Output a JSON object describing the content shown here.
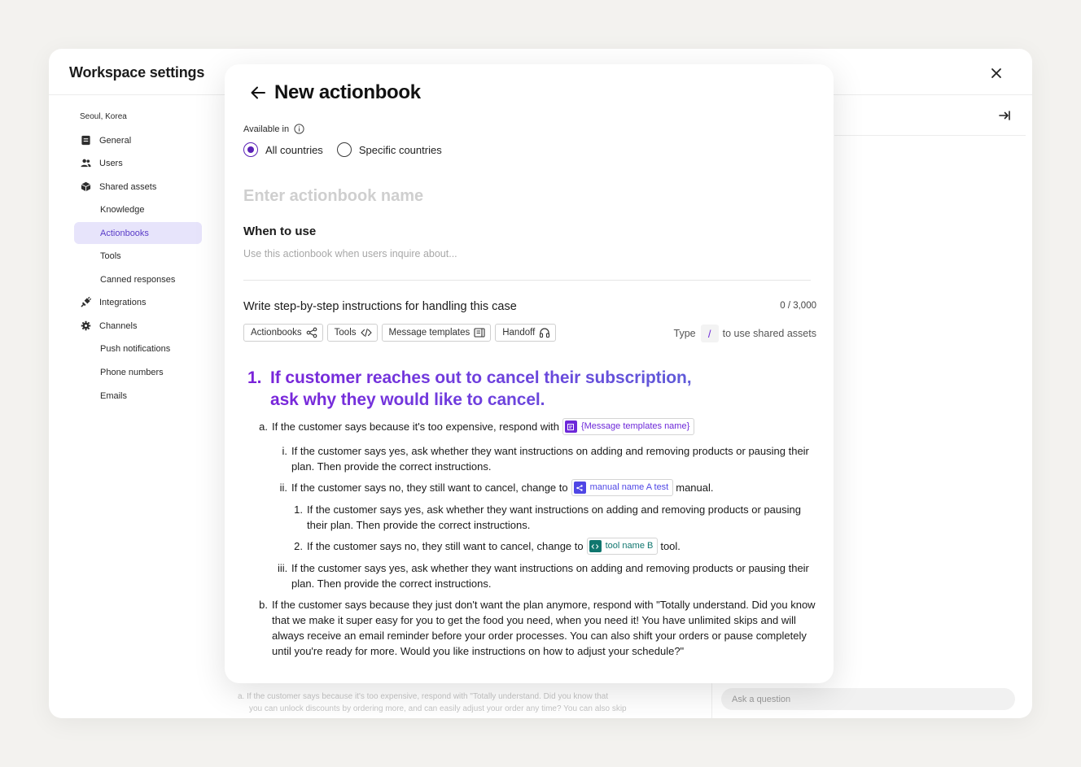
{
  "window": {
    "title": "Workspace settings",
    "close_icon": "close-icon"
  },
  "sidebar": {
    "workspace_location": "Seoul, Korea",
    "items": [
      {
        "label": "General",
        "icon": "document-icon"
      },
      {
        "label": "Users",
        "icon": "users-icon"
      },
      {
        "label": "Shared assets",
        "icon": "cube-icon"
      },
      {
        "label": "Knowledge"
      },
      {
        "label": "Actionbooks",
        "active": true
      },
      {
        "label": "Tools"
      },
      {
        "label": "Canned responses"
      },
      {
        "label": "Integrations",
        "icon": "plug-icon"
      },
      {
        "label": "Channels",
        "icon": "gear-icon"
      },
      {
        "label": "Push notifications"
      },
      {
        "label": "Phone numbers"
      },
      {
        "label": "Emails"
      }
    ]
  },
  "right_pane": {
    "collapse_icon": "arrow-right-bar-icon",
    "ask_placeholder": "Ask a question"
  },
  "background_content": {
    "line1": "a. If the customer says because it's too expensive, respond with \"Totally understand. Did you know that",
    "line2": "you can unlock discounts by ordering more, and can easily adjust your order any time? You can also skip"
  },
  "modal": {
    "title": "New actionbook",
    "available_in_label": "Available in",
    "radio_all": "All countries",
    "radio_specific": "Specific countries",
    "radio_selected": "All countries",
    "name_placeholder": "Enter actionbook name",
    "when_label": "When to use",
    "when_placeholder": "Use this actionbook when users inquire about...",
    "steps_label": "Write step-by-step instructions for handling this case",
    "char_count": "0 / 3,000",
    "chips": {
      "actionbooks": "Actionbooks",
      "tools": "Tools",
      "message_templates": "Message templates",
      "handoff": "Handoff"
    },
    "type_hint_prefix": "Type",
    "type_hint_key": "/",
    "type_hint_suffix": "to use shared assets"
  },
  "instructions": {
    "step1_num": "1.",
    "step1_line1": "If customer reaches out to cancel their subscription,",
    "step1_line2": "ask why they would like to cancel.",
    "a_marker": "a.",
    "a_text": "If the customer says because it's too expensive, respond with",
    "a_asset": "{Message templates name}",
    "a_i_marker": "i.",
    "a_i_text": "If the customer says yes, ask whether they want instructions on adding and removing products or pausing their plan. Then provide the correct instructions.",
    "a_ii_marker": "ii.",
    "a_ii_text": "If the customer says no, they still want to cancel, change to",
    "a_ii_asset": "manual name A test",
    "a_ii_suffix": "manual.",
    "a_ii_1_marker": "1.",
    "a_ii_1_text": "If the customer says yes, ask whether they want instructions on adding and removing products or pausing their plan. Then provide the correct instructions.",
    "a_ii_2_marker": "2.",
    "a_ii_2_text": "If the customer says no, they still want to cancel, change to",
    "a_ii_2_asset": "tool name B",
    "a_ii_2_suffix": "tool.",
    "a_iii_marker": "iii.",
    "a_iii_text": "If the customer says yes, ask whether they want instructions on adding and removing products or pausing their plan. Then provide the correct instructions.",
    "b_marker": "b.",
    "b_text": "If the customer says because they just don't want the plan anymore, respond with \"Totally understand. Did you know that we make it super easy for you to get the food you need, when you need it! You have unlimited skips and will always receive an email reminder before your order processes. You can also shift your orders or pause completely until you're ready for more. Would you like instructions on how to adjust your schedule?\""
  },
  "colors": {
    "accent_purple": "#6d28d9",
    "active_nav_bg": "#e7e4fb",
    "manual_indigo": "#4f46e5",
    "tool_teal": "#0f766e"
  }
}
